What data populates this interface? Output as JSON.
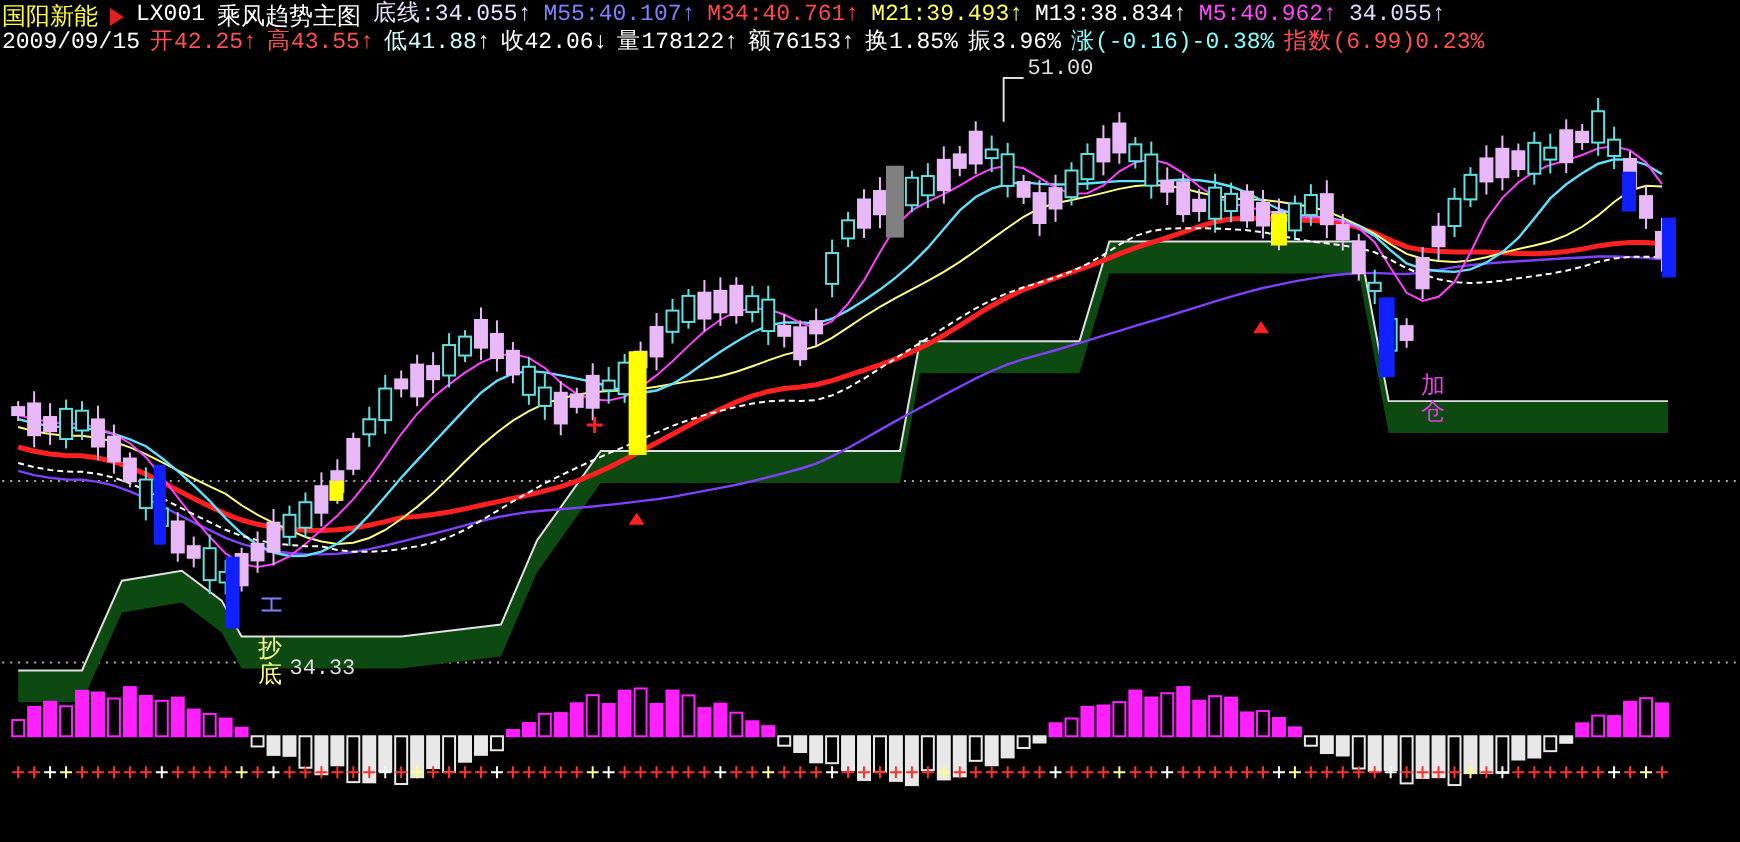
{
  "stock": {
    "name": "国阳新能",
    "code": "LX001",
    "indicator": "乘风趋势主图"
  },
  "indicator_values": [
    {
      "label": "底线:34.055",
      "arrow": "↑",
      "color": "#e8e0ff"
    },
    {
      "label": "M55:40.107",
      "arrow": "↑",
      "color": "#8080ff"
    },
    {
      "label": "M34:40.761",
      "arrow": "↑",
      "color": "#ff4848"
    },
    {
      "label": "M21:39.493",
      "arrow": "↑",
      "color": "#ffff60"
    },
    {
      "label": "M13:38.834",
      "arrow": "↑",
      "color": "#ffffff"
    },
    {
      "label": "M5:40.962",
      "arrow": "↑",
      "color": "#ff48ff"
    },
    {
      "label": "34.055",
      "arrow": "↑",
      "color": "#e0d8ff"
    }
  ],
  "quote": {
    "date": "2009/09/15",
    "fields": [
      {
        "label": "开42.25",
        "arrow": "↑",
        "color": "#ff5050"
      },
      {
        "label": "高43.55",
        "arrow": "↑",
        "color": "#ff5050"
      },
      {
        "label": "低41.88",
        "arrow": "↑",
        "color": "#d0ffff"
      },
      {
        "label": "收42.06",
        "arrow": "↓",
        "color": "#ffffff"
      },
      {
        "label": "量178122",
        "arrow": "↑",
        "color": "#ffffff"
      },
      {
        "label": "额76153",
        "arrow": "↑",
        "color": "#ffffff"
      },
      {
        "label": "换1.85%",
        "color": "#ffffff"
      },
      {
        "label": "振3.96%",
        "color": "#ffffff"
      },
      {
        "label": "涨(-0.16)-0.38%",
        "color": "#80ffff"
      },
      {
        "label": "指数(6.99)0.23%",
        "color": "#ff5050"
      }
    ]
  },
  "chart": {
    "high_label": "51.00",
    "low_label": "34.33",
    "buy_signal": "抄底",
    "add_signal": "加仓"
  }
}
